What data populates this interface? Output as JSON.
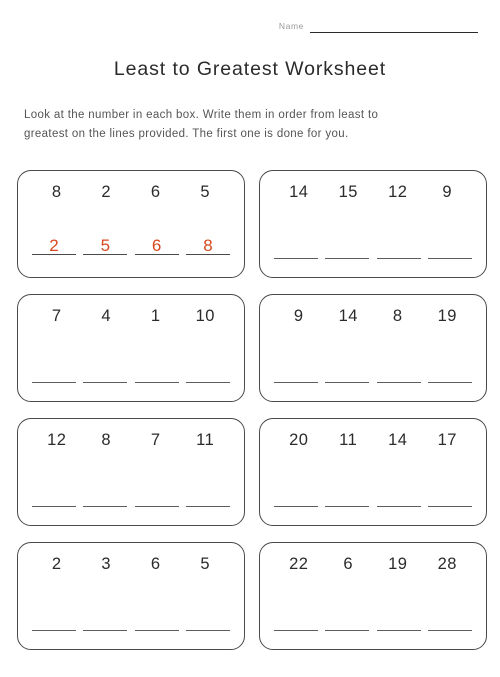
{
  "header": {
    "name_label": "Name",
    "name_value": ""
  },
  "title": "Least to Greatest Worksheet",
  "instructions": {
    "line1": "Look at the number in each box.  Write them in order from least to",
    "line2": "greatest on the lines provided.  The first one is done for you."
  },
  "colors": {
    "answer_ink": "#d8491f",
    "box_border": "#4a4a4a",
    "line": "#5d5d5d",
    "text": "#2b2b2b",
    "muted": "#9a9a9a"
  },
  "problems": [
    {
      "index": 1,
      "numbers": [
        "8",
        "2",
        "6",
        "5"
      ],
      "answers": [
        "2",
        "5",
        "6",
        "8"
      ],
      "solved": true
    },
    {
      "index": 2,
      "numbers": [
        "14",
        "15",
        "12",
        "9"
      ],
      "answers": [
        "",
        "",
        "",
        ""
      ],
      "solved": false
    },
    {
      "index": 3,
      "numbers": [
        "7",
        "4",
        "1",
        "10"
      ],
      "answers": [
        "",
        "",
        "",
        ""
      ],
      "solved": false
    },
    {
      "index": 4,
      "numbers": [
        "9",
        "14",
        "8",
        "19"
      ],
      "answers": [
        "",
        "",
        "",
        ""
      ],
      "solved": false
    },
    {
      "index": 5,
      "numbers": [
        "12",
        "8",
        "7",
        "11"
      ],
      "answers": [
        "",
        "",
        "",
        ""
      ],
      "solved": false
    },
    {
      "index": 6,
      "numbers": [
        "20",
        "11",
        "14",
        "17"
      ],
      "answers": [
        "",
        "",
        "",
        ""
      ],
      "solved": false
    },
    {
      "index": 7,
      "numbers": [
        "2",
        "3",
        "6",
        "5"
      ],
      "answers": [
        "",
        "",
        "",
        ""
      ],
      "solved": false
    },
    {
      "index": 8,
      "numbers": [
        "22",
        "6",
        "19",
        "28"
      ],
      "answers": [
        "",
        "",
        "",
        ""
      ],
      "solved": false
    }
  ]
}
